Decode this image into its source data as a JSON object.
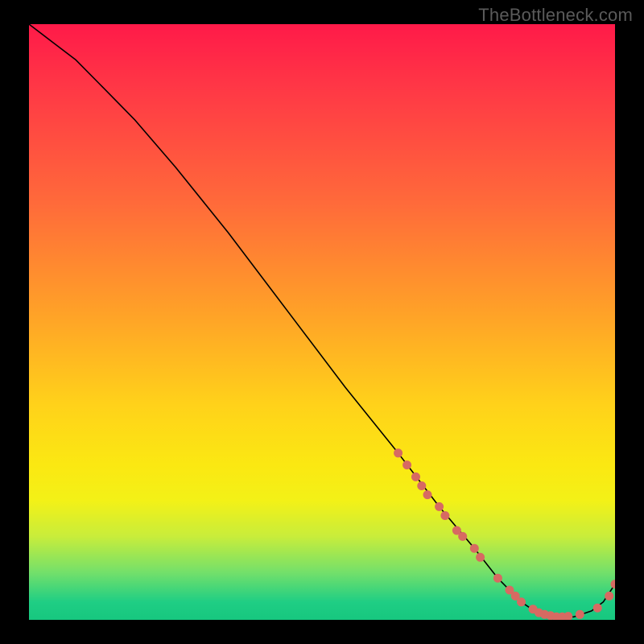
{
  "watermark": "TheBottleneck.com",
  "chart_data": {
    "type": "line",
    "title": "",
    "xlabel": "",
    "ylabel": "",
    "xlim": [
      0,
      100
    ],
    "ylim": [
      0,
      100
    ],
    "grid": false,
    "legend": false,
    "series": [
      {
        "name": "bottleneck-curve",
        "x": [
          0,
          4,
          8,
          12,
          18,
          25,
          34,
          44,
          54,
          63,
          70,
          76,
          80,
          84,
          87,
          90,
          93,
          96,
          98,
          100
        ],
        "y": [
          100,
          97,
          94,
          90,
          84,
          76,
          65,
          52,
          39,
          28,
          19,
          12,
          7,
          3,
          1,
          0.5,
          0.5,
          1.5,
          3,
          6
        ]
      }
    ],
    "scatter_points": {
      "name": "sample-points",
      "x": [
        63,
        64.5,
        66,
        67,
        68,
        70,
        71,
        73,
        74,
        76,
        77,
        80,
        82,
        83,
        84,
        86,
        87,
        88,
        89,
        90,
        91,
        92,
        94,
        97,
        99,
        100
      ],
      "y": [
        28,
        26,
        24,
        22.5,
        21,
        19,
        17.5,
        15,
        14,
        12,
        10.5,
        7,
        5,
        4,
        3,
        1.8,
        1.2,
        0.9,
        0.7,
        0.5,
        0.5,
        0.6,
        0.9,
        2,
        4,
        6
      ]
    },
    "gradient_stops": [
      {
        "pct": 0,
        "color": "#ff1a49"
      },
      {
        "pct": 30,
        "color": "#ff6a3a"
      },
      {
        "pct": 64,
        "color": "#ffd21a"
      },
      {
        "pct": 86,
        "color": "#c8ed3b"
      },
      {
        "pct": 100,
        "color": "#17c77f"
      }
    ]
  }
}
